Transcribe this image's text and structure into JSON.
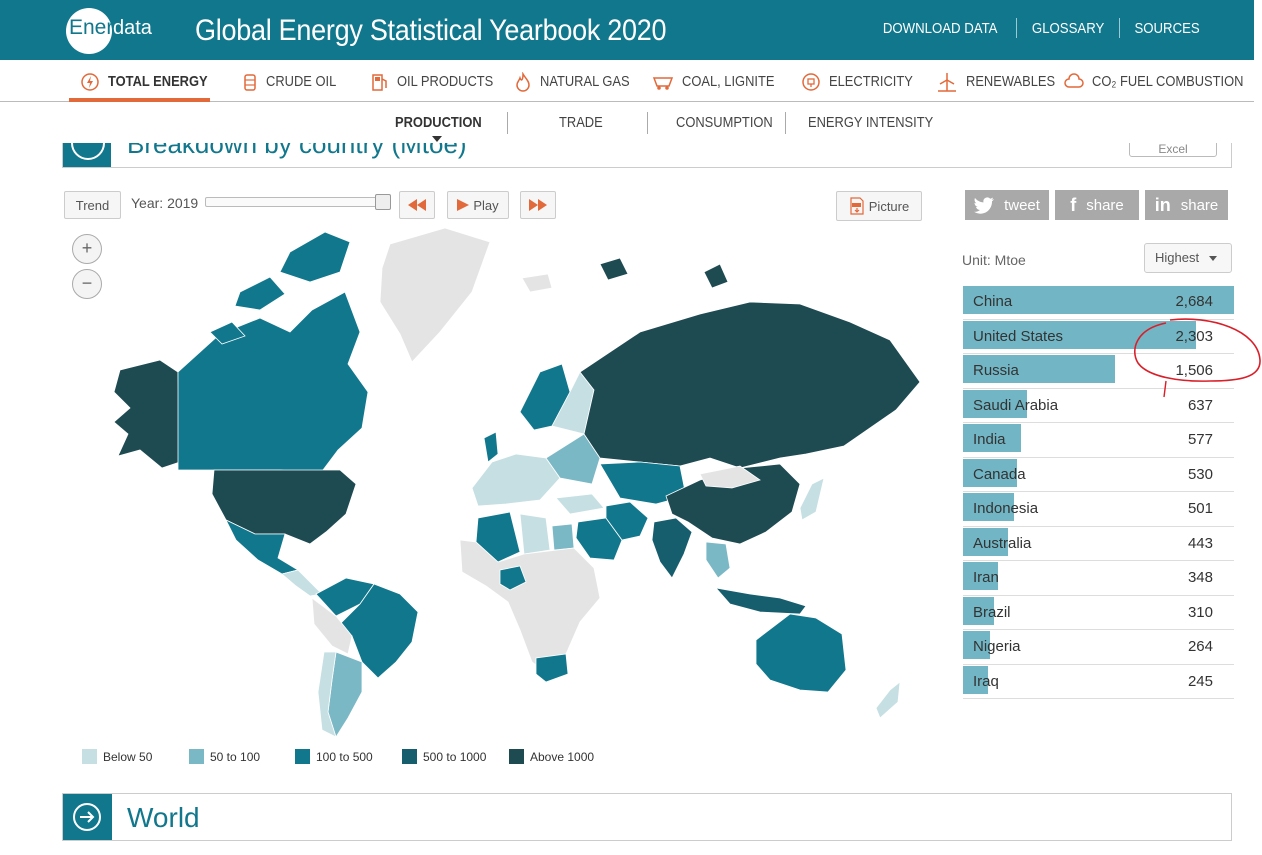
{
  "header": {
    "logo_part1": "Ener",
    "logo_part2": "data",
    "title": "Global Energy Statistical Yearbook 2020",
    "links": [
      "DOWNLOAD DATA",
      "GLOSSARY",
      "SOURCES"
    ]
  },
  "nav": {
    "items": [
      {
        "label": "TOTAL ENERGY",
        "icon": "power-icon",
        "active": true
      },
      {
        "label": "CRUDE OIL",
        "icon": "oil-barrel-icon"
      },
      {
        "label": "OIL PRODUCTS",
        "icon": "fuel-pump-icon"
      },
      {
        "label": "NATURAL GAS",
        "icon": "flame-icon"
      },
      {
        "label": "COAL, LIGNITE",
        "icon": "mine-cart-icon"
      },
      {
        "label": "ELECTRICITY",
        "icon": "plug-icon"
      },
      {
        "label": "RENEWABLES",
        "icon": "wind-turbine-icon"
      },
      {
        "label": "CO₂ FUEL COMBUSTION",
        "icon": "cloud-icon"
      }
    ],
    "subitems": [
      {
        "label": "PRODUCTION",
        "active": true
      },
      {
        "label": "TRADE"
      },
      {
        "label": "CONSUMPTION"
      },
      {
        "label": "ENERGY INTENSITY"
      }
    ]
  },
  "section": {
    "title": "Breakdown by country (Mtoe)",
    "excel_label": "Excel"
  },
  "controls": {
    "trend": "Trend",
    "year_label": "Year: 2019",
    "play": "Play",
    "picture": "Picture",
    "zoom_in": "+",
    "zoom_out": "−",
    "tweet": "tweet",
    "share_fb": "share",
    "share_in": "share",
    "unit": "Unit: Mtoe",
    "sort": "Highest"
  },
  "legend": [
    {
      "label": "Below 50",
      "color": "#c5dfe3"
    },
    {
      "label": "50 to 100",
      "color": "#7ab8c6"
    },
    {
      "label": "100 to 500",
      "color": "#11778d"
    },
    {
      "label": "500 to 1000",
      "color": "#165e6e"
    },
    {
      "label": "Above 1000",
      "color": "#1e4a52"
    }
  ],
  "chart_data": {
    "type": "bar",
    "categories": [
      "China",
      "United States",
      "Russia",
      "Saudi Arabia",
      "India",
      "Canada",
      "Indonesia",
      "Australia",
      "Iran",
      "Brazil",
      "Nigeria",
      "Iraq"
    ],
    "values": [
      2684,
      2303,
      1506,
      637,
      577,
      530,
      501,
      443,
      348,
      310,
      264,
      245
    ],
    "display_values": [
      "2,684",
      "2,303",
      "1,506",
      "637",
      "577",
      "530",
      "501",
      "443",
      "348",
      "310",
      "264",
      "245"
    ],
    "bar_color": "#72b6c5",
    "ylabel": "Mtoe",
    "year": 2019
  },
  "world": {
    "title": "World"
  }
}
